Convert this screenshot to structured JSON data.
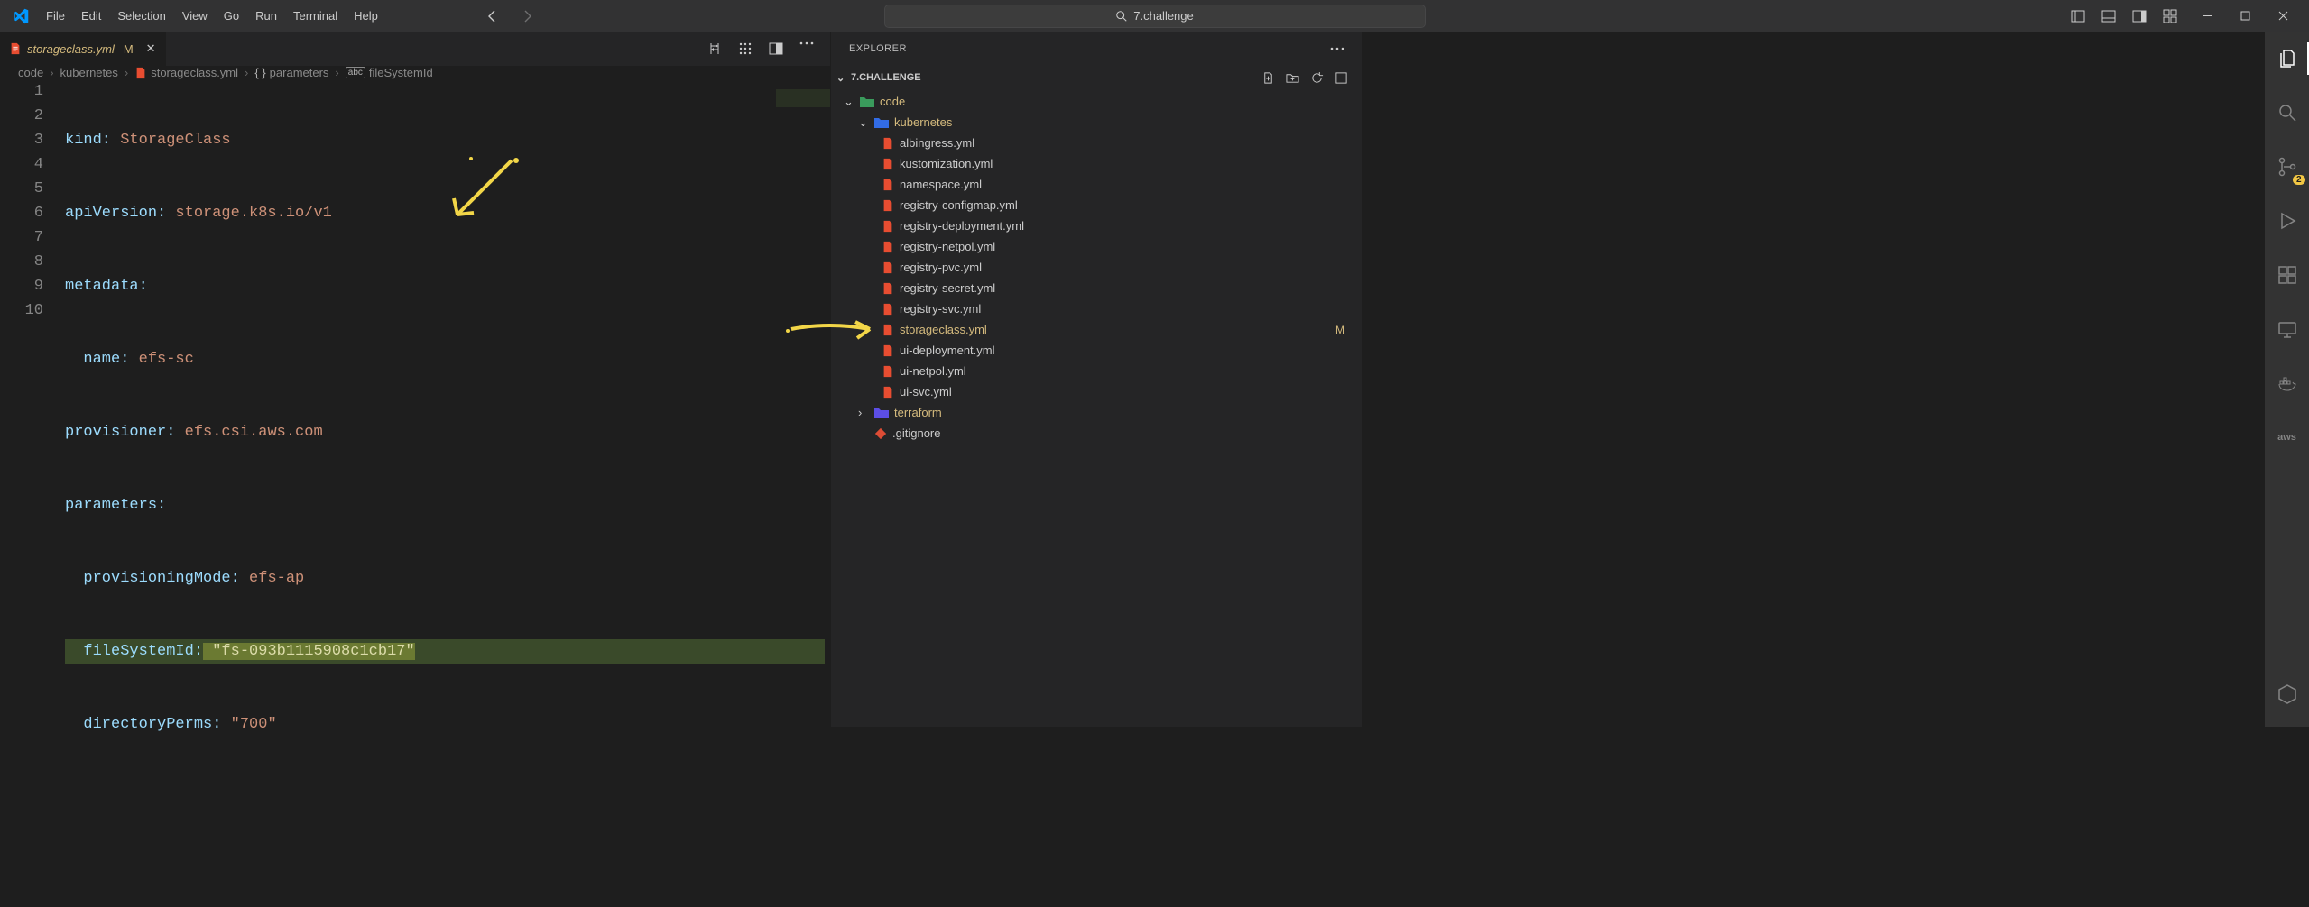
{
  "menu": [
    "File",
    "Edit",
    "Selection",
    "View",
    "Go",
    "Run",
    "Terminal",
    "Help"
  ],
  "search": {
    "placeholder": "7.challenge"
  },
  "tab": {
    "name": "storageclass.yml",
    "status": "M"
  },
  "breadcrumbs": {
    "root": "code",
    "folder": "kubernetes",
    "file": "storageclass.yml",
    "section": "parameters",
    "field": "fileSystemId"
  },
  "lines": [
    "1",
    "2",
    "3",
    "4",
    "5",
    "6",
    "7",
    "8",
    "9",
    "10"
  ],
  "code": {
    "l1a": "kind:",
    "l1b": " StorageClass",
    "l2a": "apiVersion:",
    "l2b": " storage.k8s.io/v1",
    "l3a": "metadata:",
    "l4a": "  name:",
    "l4b": " efs-sc",
    "l5a": "provisioner:",
    "l5b": " efs.csi.aws.com",
    "l6a": "parameters:",
    "l7a": "  provisioningMode:",
    "l7b": " efs-ap",
    "l8a": "  fileSystemId:",
    "l8b": " \"fs-093b1115908c1cb17\"",
    "l9a": "  directoryPerms:",
    "l9b": " \"700\""
  },
  "explorer": {
    "title": "EXPLORER",
    "project": "7.CHALLENGE",
    "folders": {
      "code": "code",
      "kubernetes": "kubernetes",
      "terraform": "terraform"
    },
    "files": [
      "albingress.yml",
      "kustomization.yml",
      "namespace.yml",
      "registry-configmap.yml",
      "registry-deployment.yml",
      "registry-netpol.yml",
      "registry-pvc.yml",
      "registry-secret.yml",
      "registry-svc.yml",
      "storageclass.yml",
      "ui-deployment.yml",
      "ui-netpol.yml",
      "ui-svc.yml"
    ],
    "gitignore": ".gitignore",
    "modified_badge": "M",
    "scm_badge": "2"
  }
}
